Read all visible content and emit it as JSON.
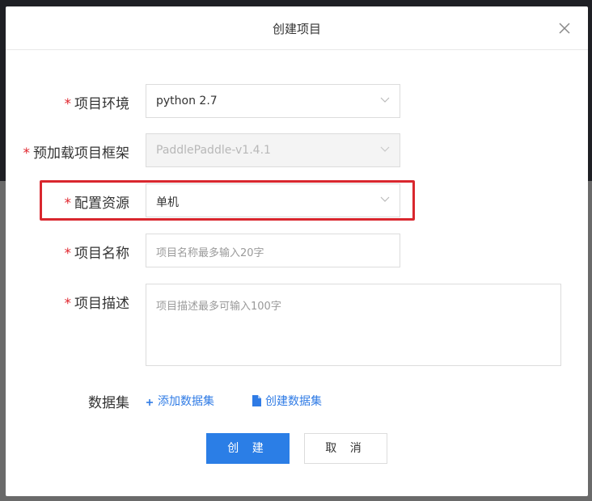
{
  "modal": {
    "title": "创建项目",
    "close_label": "×"
  },
  "form": {
    "required_mark": "*",
    "environment": {
      "label": "项目环境",
      "value": "python 2.7"
    },
    "framework": {
      "label": "预加载项目框架",
      "value": "PaddlePaddle-v1.4.1"
    },
    "resource": {
      "label": "配置资源",
      "value": "单机"
    },
    "name": {
      "label": "项目名称",
      "placeholder": "项目名称最多输入20字"
    },
    "description": {
      "label": "项目描述",
      "placeholder": "项目描述最多可输入100字"
    },
    "dataset": {
      "label": "数据集",
      "add_label": "添加数据集",
      "create_label": "创建数据集"
    }
  },
  "actions": {
    "create_label": "创 建",
    "cancel_label": "取 消"
  },
  "colors": {
    "primary": "#2b7ee6",
    "required": "#e0242c",
    "highlight": "#d9272e",
    "link": "#2f7be5"
  }
}
